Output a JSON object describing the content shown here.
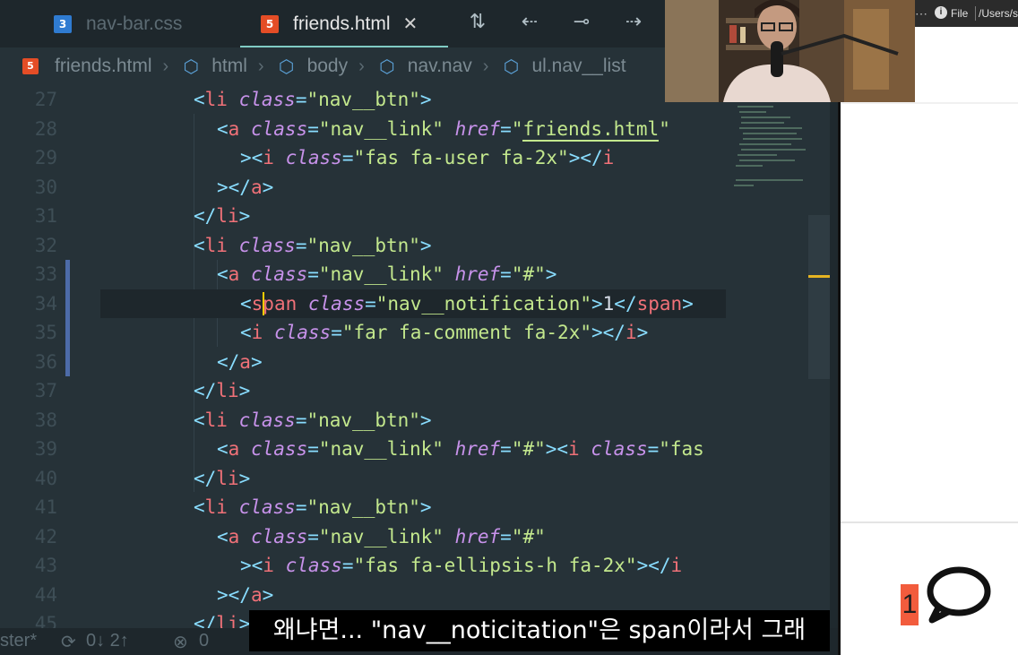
{
  "tabs": [
    {
      "label": "nav-bar.css",
      "icon": "css3-icon"
    },
    {
      "label": "friends.html",
      "icon": "html5-icon",
      "close": "✕"
    }
  ],
  "toolbar_icons": [
    "git-compare-icon",
    "git-commit-back-icon",
    "git-commit-icon",
    "git-commit-forward-icon"
  ],
  "breadcrumb": [
    "friends.html",
    "html",
    "body",
    "nav.nav",
    "ul.nav__list"
  ],
  "line_numbers": [
    "27",
    "28",
    "29",
    "30",
    "31",
    "32",
    "33",
    "34",
    "35",
    "36",
    "37",
    "38",
    "39",
    "40",
    "41",
    "42",
    "43",
    "44",
    "45"
  ],
  "code_strings": {
    "li": "li",
    "a": "a",
    "i": "i",
    "span": "span",
    "class": "class",
    "href": "href",
    "nav_btn": "\"nav__btn\"",
    "nav_link": "\"nav__link\"",
    "friends_href": "friends.html",
    "hash": "\"#\"",
    "fa_user": "\"fas fa-user fa-2x\"",
    "nav_notification": "\"nav__notification\"",
    "notif_value": "1",
    "fa_comment": "\"far fa-comment fa-2x\"",
    "fas_trunc": "\"fas",
    "fa_ellipsis": "\"fas fa-ellipsis-h fa-2x\""
  },
  "statusbar": {
    "branch": "ster*",
    "sync": "0↓ 2↑",
    "errors": "0"
  },
  "browser": {
    "file_label": "File",
    "url": "/Users/se",
    "notification_count": "1"
  },
  "subtitle": "왜냐면... \"nav__noticitation\"은 span이라서 그래",
  "colors": {
    "editor_bg": "#263238",
    "tag": "#f07178",
    "attr": "#c792ea",
    "string": "#c3e88d",
    "punct": "#89ddff",
    "notification_badge": "#f25c3d"
  }
}
